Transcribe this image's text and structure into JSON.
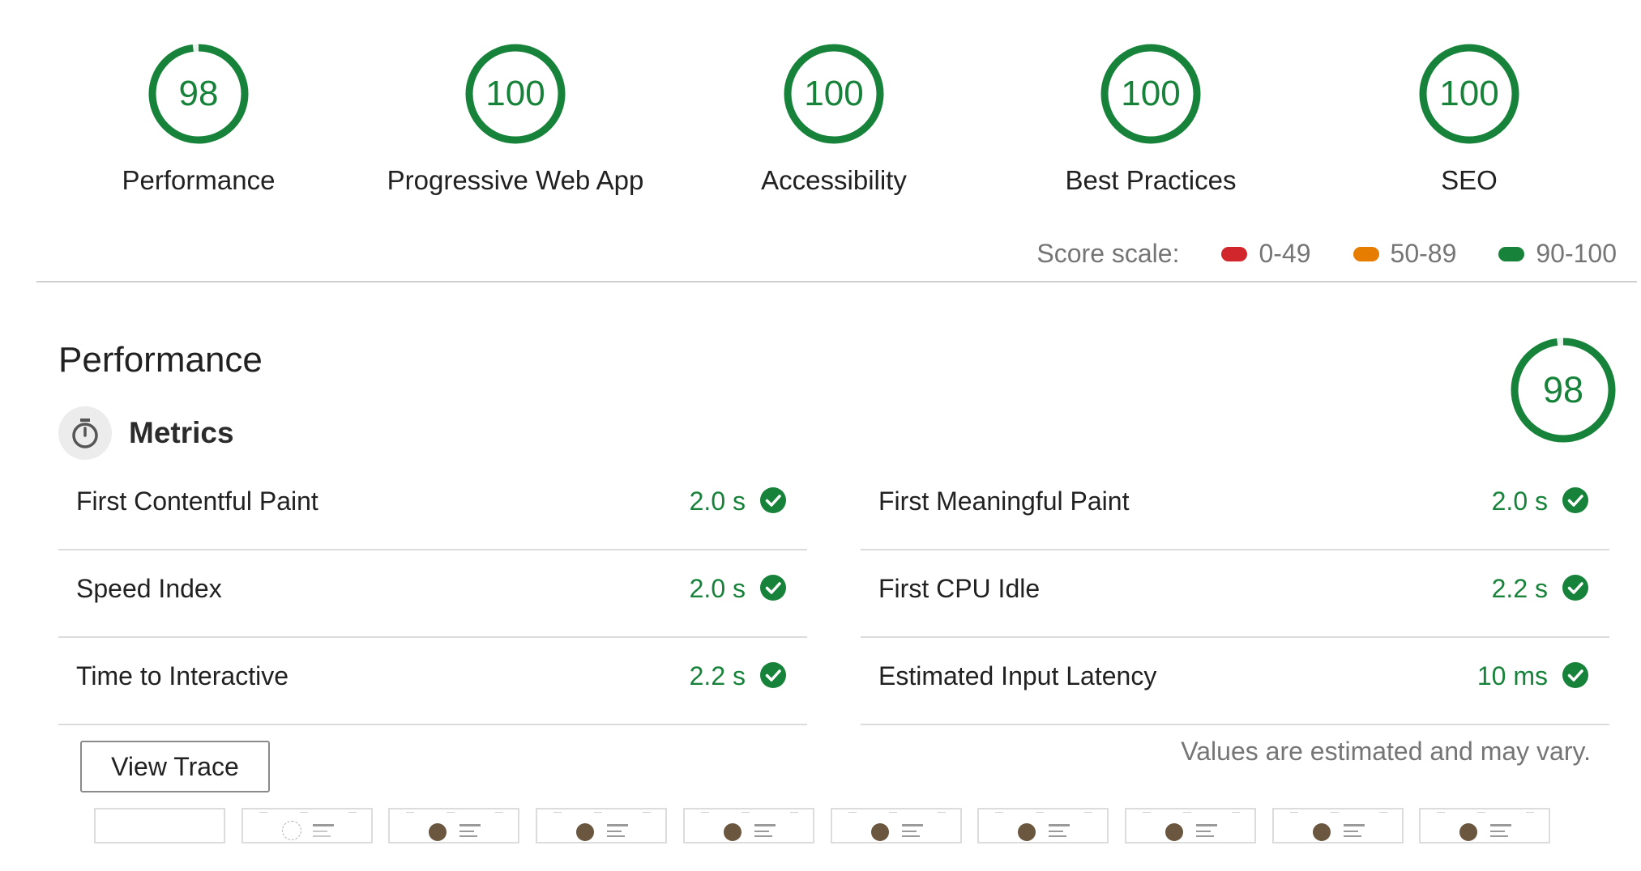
{
  "categories": [
    {
      "name": "Performance",
      "score": "98",
      "score_value": 98
    },
    {
      "name": "Progressive Web App",
      "score": "100",
      "score_value": 100
    },
    {
      "name": "Accessibility",
      "score": "100",
      "score_value": 100
    },
    {
      "name": "Best Practices",
      "score": "100",
      "score_value": 100
    },
    {
      "name": "SEO",
      "score": "100",
      "score_value": 100
    }
  ],
  "score_scale": {
    "label": "Score scale:",
    "ranges": [
      {
        "label": "0-49",
        "color": "#d2262d"
      },
      {
        "label": "50-89",
        "color": "#e67c00"
      },
      {
        "label": "90-100",
        "color": "#178239"
      }
    ]
  },
  "performance": {
    "title": "Performance",
    "score": "98",
    "score_value": 98,
    "metrics_title": "Metrics",
    "metrics_icon": "stopwatch-icon",
    "metrics_left": [
      {
        "name": "First Contentful Paint",
        "value": "2.0 s"
      },
      {
        "name": "Speed Index",
        "value": "2.0 s"
      },
      {
        "name": "Time to Interactive",
        "value": "2.2 s"
      }
    ],
    "metrics_right": [
      {
        "name": "First Meaningful Paint",
        "value": "2.0 s"
      },
      {
        "name": "First CPU Idle",
        "value": "2.2 s"
      },
      {
        "name": "Estimated Input Latency",
        "value": "10 ms"
      }
    ],
    "view_trace_label": "View Trace",
    "note": "Values are estimated and may vary.",
    "filmstrip_frames": 10
  },
  "colors": {
    "pass": "#178239",
    "fail": "#d2262d",
    "average": "#e67c00"
  }
}
